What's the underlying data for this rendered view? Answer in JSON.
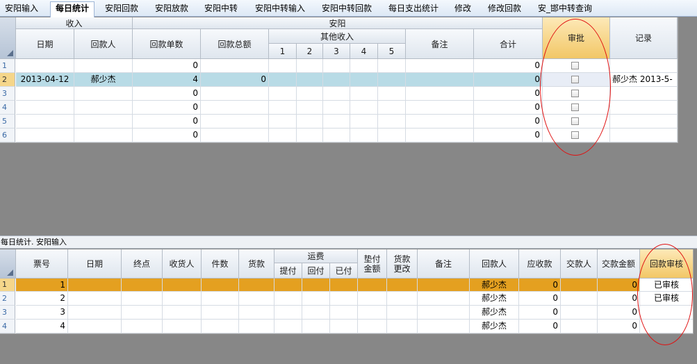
{
  "tabs": [
    "安阳输入",
    "每日统计",
    "安阳回款",
    "安阳放款",
    "安阳中转",
    "安阳中转输入",
    "安阳中转回款",
    "每日支出统计",
    "修改",
    "修改回款",
    "安_邯中转查询"
  ],
  "active_tab": 1,
  "upper": {
    "group_income": "收入",
    "group_anyang": "安阳",
    "group_other_income": "其他收入",
    "col_date": "日期",
    "col_payer": "回款人",
    "col_count": "回款单数",
    "col_total": "回款总额",
    "col_o1": "1",
    "col_o2": "2",
    "col_o3": "3",
    "col_o4": "4",
    "col_o5": "5",
    "col_note": "备注",
    "col_sum": "合计",
    "col_approve": "审批",
    "col_record": "记录",
    "rows": [
      {
        "n": "1",
        "date": "",
        "payer": "",
        "count": "0",
        "total": "",
        "sum": "0",
        "record": ""
      },
      {
        "n": "2",
        "date": "2013-04-12",
        "payer": "郝少杰",
        "count": "4",
        "total": "0",
        "sum": "0",
        "record": "郝少杰 2013-5-"
      },
      {
        "n": "3",
        "date": "",
        "payer": "",
        "count": "0",
        "total": "",
        "sum": "0",
        "record": ""
      },
      {
        "n": "4",
        "date": "",
        "payer": "",
        "count": "0",
        "total": "",
        "sum": "0",
        "record": ""
      },
      {
        "n": "5",
        "date": "",
        "payer": "",
        "count": "0",
        "total": "",
        "sum": "0",
        "record": ""
      },
      {
        "n": "6",
        "date": "",
        "payer": "",
        "count": "0",
        "total": "",
        "sum": "0",
        "record": ""
      }
    ]
  },
  "caption": "每日统计. 安阳输入",
  "lower": {
    "col_ticket": "票号",
    "col_date": "日期",
    "col_dest": "终点",
    "col_consignee": "收货人",
    "col_pieces": "件数",
    "col_goods": "货款",
    "group_freight": "运费",
    "col_pickup": "提付",
    "col_return": "回付",
    "col_paid": "已付",
    "col_advance": "垫付\n金额",
    "col_advance_1": "垫付",
    "col_advance_2": "金额",
    "col_change_1": "货款",
    "col_change_2": "更改",
    "col_note": "备注",
    "col_payer": "回款人",
    "col_receivable": "应收款",
    "col_submitter": "交款人",
    "col_amount": "交款金额",
    "col_audit": "回款审核",
    "rows": [
      {
        "n": "1",
        "ticket": "1",
        "payer": "郝少杰",
        "receivable": "0",
        "amount": "0",
        "audit": "已审核"
      },
      {
        "n": "2",
        "ticket": "2",
        "payer": "郝少杰",
        "receivable": "0",
        "amount": "0",
        "audit": "已审核"
      },
      {
        "n": "3",
        "ticket": "3",
        "payer": "郝少杰",
        "receivable": "0",
        "amount": "0",
        "audit": ""
      },
      {
        "n": "4",
        "ticket": "4",
        "payer": "郝少杰",
        "receivable": "0",
        "amount": "0",
        "audit": ""
      }
    ]
  },
  "colors": {
    "selected_row_upper": "#b8dbe6",
    "selected_row_lower": "#e4a020",
    "highlight_header": "#f2c766",
    "annotation_ellipse": "#e01010"
  }
}
